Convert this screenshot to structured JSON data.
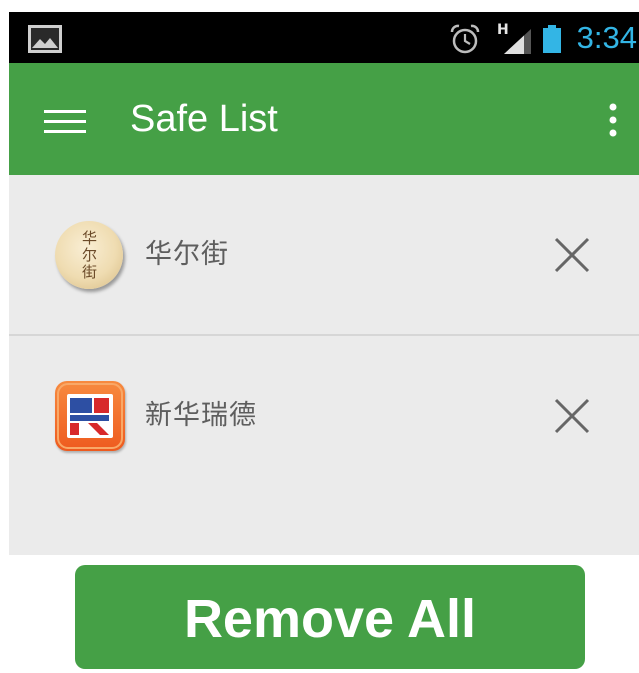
{
  "status_bar": {
    "network_type": "H",
    "time": "3:34",
    "time_color": "#33b5e5",
    "icons": {
      "notification": "gallery-icon",
      "alarm": "alarm-clock-icon",
      "signal": "signal-icon",
      "battery": "battery-icon"
    }
  },
  "app_bar": {
    "title": "Safe List",
    "menu_icon": "hamburger-menu-icon",
    "overflow_icon": "overflow-menu-icon",
    "color": "#45a046"
  },
  "safe_list": {
    "items": [
      {
        "name": "华尔街",
        "icon": "huaerjie-app-icon",
        "icon_text": "华尔街",
        "remove_icon": "close-icon"
      },
      {
        "name": "新华瑞德",
        "icon": "xinhuaruide-app-icon",
        "remove_icon": "close-icon"
      }
    ]
  },
  "footer": {
    "remove_all_label": "Remove All",
    "button_color": "#45a046"
  }
}
